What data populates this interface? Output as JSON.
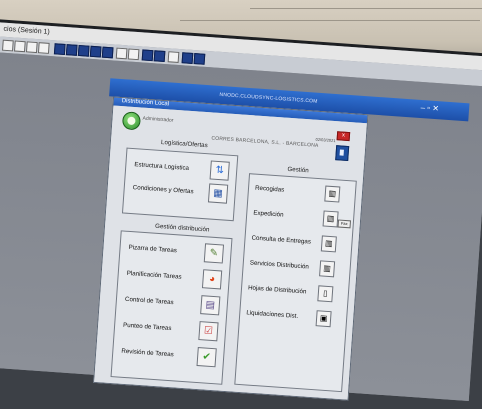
{
  "session": {
    "title": "cios (Sesión 1)"
  },
  "appbar": {
    "url": "NNODC.CLOUDSYNC-LOGISTICS.COM",
    "controls": "– ▫ ✕"
  },
  "window": {
    "title": "Distribución Local",
    "user": "Administrador",
    "company": "CORRES BARCELONA, S.L. - BARCELONA",
    "date": "02/03/2021",
    "close_label": "x"
  },
  "logistica": {
    "title": "Logística/Ofertas",
    "items": [
      "Estructura Logística",
      "Condiciones y Ofertas"
    ]
  },
  "distribucion": {
    "title": "Gestión distribución",
    "items": [
      "Pizarra de Tareas",
      "Planificación Tareas",
      "Control de Tareas",
      "Punteo de Tareas",
      "Revisión de Tareas"
    ]
  },
  "gestion": {
    "title": "Gestión",
    "items": [
      "Recogidas",
      "Expedición",
      "Consulta de Entregas",
      "Servicios Distribución",
      "Hojas de Distribución",
      "Liquidaciones Dist."
    ],
    "fax_label": "Fax"
  },
  "icons": {
    "logistica": [
      "arrows-icon",
      "calendar-icon"
    ],
    "distribucion": [
      "document-pencil-icon",
      "pie-chart-icon",
      "notepad-icon",
      "checklist-icon",
      "checkmark-icon"
    ],
    "gestion": [
      "barcode-icon",
      "barcode-icon",
      "barcode-icon",
      "barcode-icon",
      "document-icon",
      "cash-register-icon"
    ]
  }
}
